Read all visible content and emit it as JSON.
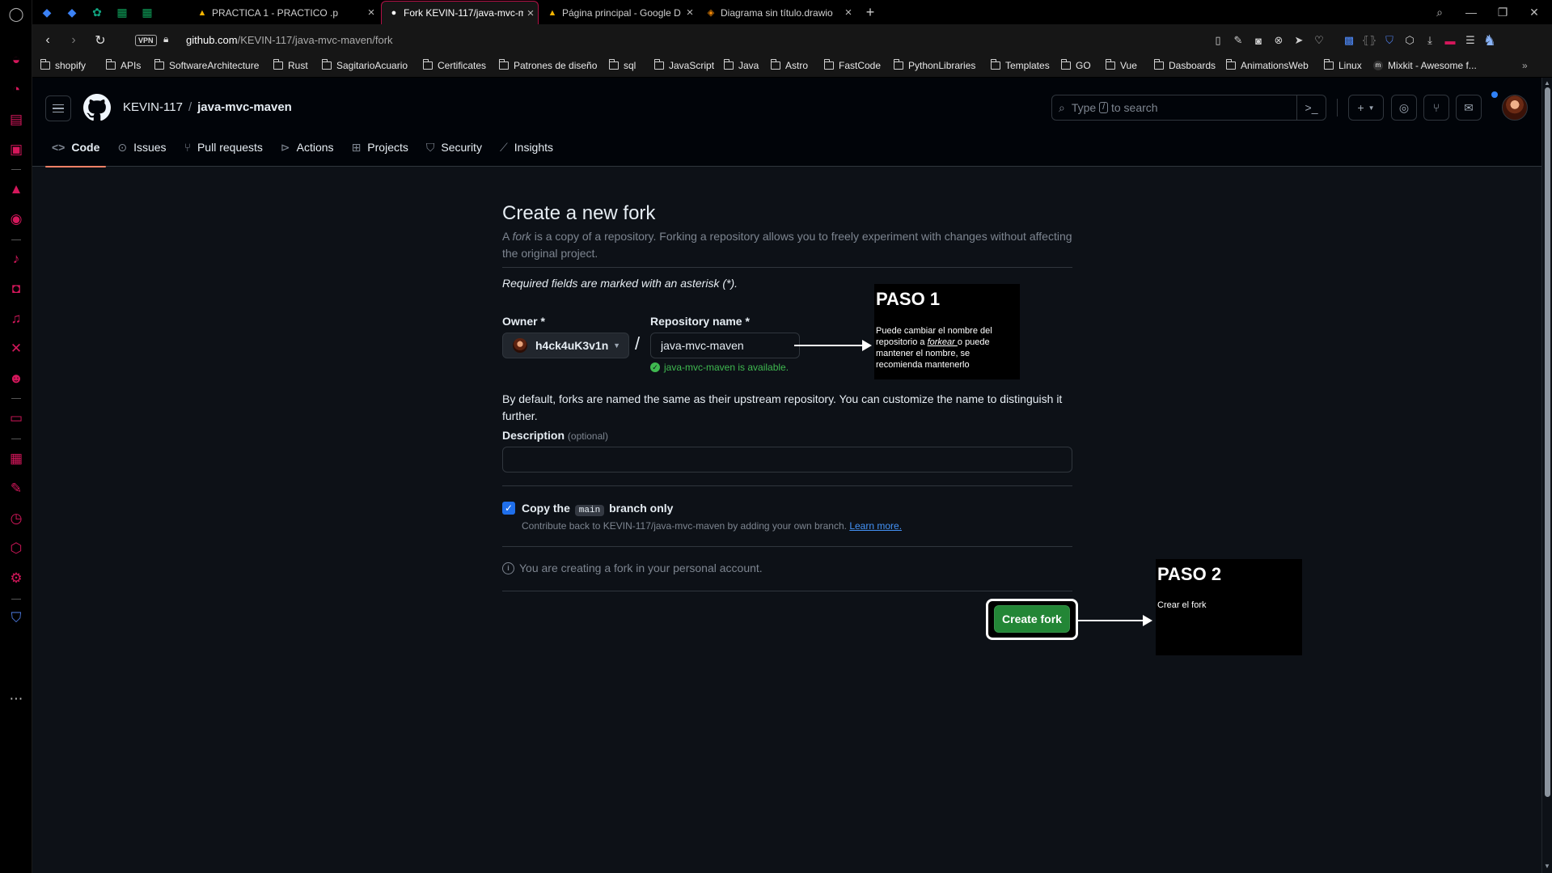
{
  "browser": {
    "tabs": [
      {
        "title": "PRACTICA 1 - PRACTICO .p",
        "close": "×"
      },
      {
        "title": "Fork KEVIN-117/java-mvc-m",
        "close": "×"
      },
      {
        "title": "Página principal - Google D",
        "close": "×"
      },
      {
        "title": "Diagrama sin título.drawio",
        "close": "×"
      }
    ],
    "new_tab": "+",
    "vpn": "VPN",
    "url_host": "github.com",
    "url_path": "/KEVIN-117/java-mvc-maven/fork",
    "bookmarks": [
      "shopify",
      "APIs",
      "SoftwareArchitecture",
      "Rust",
      "SagitarioAcuario",
      "Certificates",
      "Patrones de diseño",
      "sql",
      "JavaScript",
      "Java",
      "Astro",
      "FastCode",
      "PythonLibraries",
      "Templates",
      "GO",
      "Vue",
      "Dasboards",
      "AnimationsWeb",
      "Linux",
      "Mixkit - Awesome f..."
    ],
    "accent": "#d4175b"
  },
  "github": {
    "owner_crumb": "KEVIN-117",
    "separator": "/",
    "repo_crumb": "java-mvc-maven",
    "search_pre": "Type",
    "search_key": "/",
    "search_post": "to search",
    "tabs": [
      {
        "label": "Code",
        "icon": "code-icon"
      },
      {
        "label": "Issues",
        "icon": "issue-icon"
      },
      {
        "label": "Pull requests",
        "icon": "pull-request-icon"
      },
      {
        "label": "Actions",
        "icon": "play-icon"
      },
      {
        "label": "Projects",
        "icon": "table-icon"
      },
      {
        "label": "Security",
        "icon": "shield-icon"
      },
      {
        "label": "Insights",
        "icon": "graph-icon"
      }
    ]
  },
  "form": {
    "title": "Create a new fork",
    "intro_a": "A ",
    "intro_fork": "fork",
    "intro_b": " is a copy of a repository. Forking a repository allows you to freely experiment with changes without affecting the original project.",
    "required_note": "Required fields are marked with an asterisk (*).",
    "owner_label": "Owner *",
    "owner_value": "h4ck4uK3v1n",
    "slash": "/",
    "repo_label": "Repository name *",
    "repo_value": "java-mvc-maven",
    "available": "java-mvc-maven is available.",
    "default_note": "By default, forks are named the same as their upstream repository. You can customize the name to distinguish it further.",
    "desc_label": "Description",
    "desc_optional": "(optional)",
    "copy_a": "Copy the",
    "copy_code": "main",
    "copy_b": "branch only",
    "contrib_text": "Contribute back to KEVIN-117/java-mvc-maven by adding your own branch.",
    "learn_more": "Learn more.",
    "personal_note": "You are creating a fork in your personal account.",
    "create_button": "Create fork"
  },
  "annotations": {
    "step1_title": "PASO 1",
    "step1_a": "Puede cambiar el nombre del repositorio a ",
    "step1_em": "forkear ",
    "step1_b": "o puede mantener el nombre, se recomienda mantenerlo",
    "step2_title": "PASO 2",
    "step2_body": "Crear el fork"
  },
  "colors": {
    "github_bg": "#0d1117",
    "primary_button": "#238636",
    "link": "#4493f8",
    "success": "#3fb950",
    "tab_underline": "#f78166"
  }
}
